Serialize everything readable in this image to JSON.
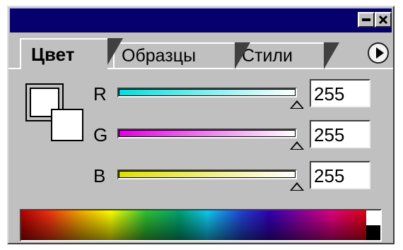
{
  "tabs": [
    {
      "label": "Цвет",
      "active": true
    },
    {
      "label": "Образцы",
      "active": false
    },
    {
      "label": "Стили",
      "active": false
    }
  ],
  "channels": [
    {
      "label": "R",
      "value": "255",
      "level": 1.0,
      "gradient_from": "#00e0e0",
      "gradient_to": "#ffffff"
    },
    {
      "label": "G",
      "value": "255",
      "level": 1.0,
      "gradient_from": "#e000e0",
      "gradient_to": "#ffffff"
    },
    {
      "label": "B",
      "value": "255",
      "level": 1.0,
      "gradient_from": "#e0e000",
      "gradient_to": "#ffffff"
    }
  ],
  "foreground_color": "#ffffff",
  "background_color": "#ffffff",
  "icons": [
    "minimize-icon",
    "close-icon",
    "panel-menu-icon"
  ],
  "colors": {
    "titlebar": "#06006e",
    "panel": "#c0c0c0"
  }
}
